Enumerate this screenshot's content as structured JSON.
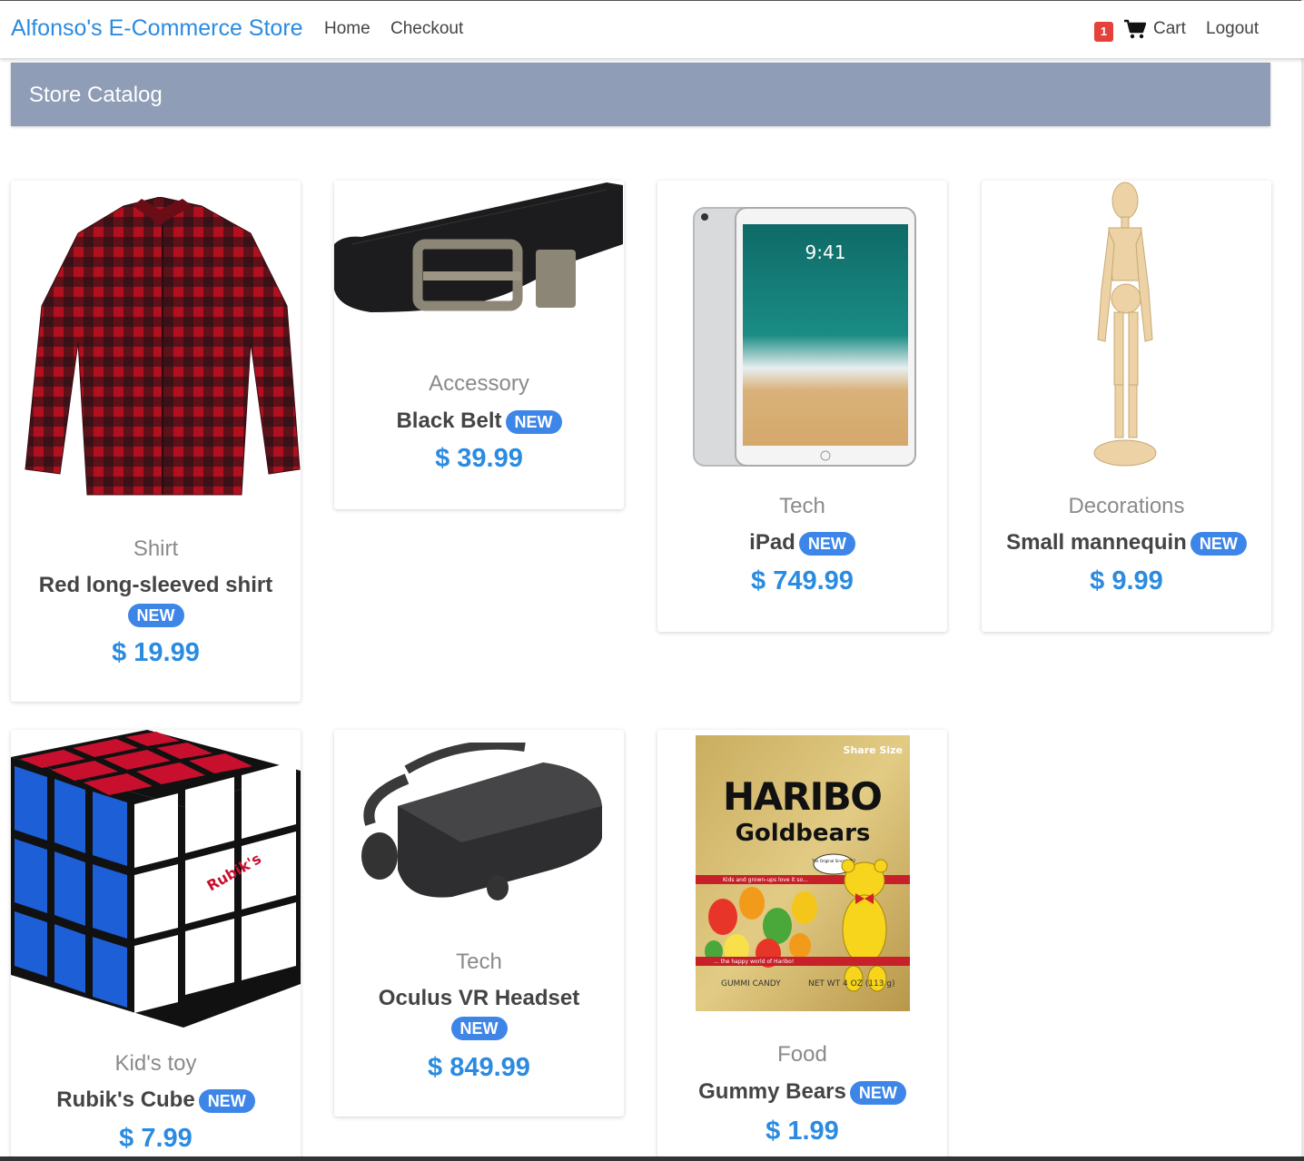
{
  "navbar": {
    "brand": "Alfonso's E-Commerce Store",
    "links": [
      "Home",
      "Checkout"
    ],
    "cart_count": "1",
    "cart_label": "Cart",
    "logout_label": "Logout"
  },
  "catalog": {
    "title": "Store Catalog"
  },
  "new_badge": "NEW",
  "products": [
    {
      "category": "Shirt",
      "name": "Red long-sleeved shirt",
      "price": "$ 19.99"
    },
    {
      "category": "Accessory",
      "name": "Black Belt",
      "price": "$ 39.99"
    },
    {
      "category": "Tech",
      "name": "iPad",
      "price": "$ 749.99"
    },
    {
      "category": "Decorations",
      "name": "Small mannequin",
      "price": "$ 9.99"
    },
    {
      "category": "Kid's toy",
      "name": "Rubik's Cube",
      "price": "$ 7.99"
    },
    {
      "category": "Tech",
      "name": "Oculus VR Headset",
      "price": "$ 849.99"
    },
    {
      "category": "Food",
      "name": "Gummy Bears",
      "price": "$ 1.99"
    }
  ],
  "product_image_text": {
    "haribo_brand": "HARIBO",
    "haribo_product": "Goldbears",
    "haribo_share": "Share Size",
    "haribo_gummi": "GUMMI CANDY",
    "haribo_weight": "NET WT 4 OZ (113 g)",
    "haribo_tagline": "Kids and grown-ups love it so...",
    "haribo_slogan": "... the happy world of Haribo!",
    "haribo_since": "The Original Since 1922",
    "ipad_time": "9:41",
    "rubiks_logo": "Rubik's"
  },
  "colors": {
    "brand": "#2b8be0",
    "catalog_bar": "#8f9db7",
    "badge": "#e6403b",
    "new_badge": "#3d86e8",
    "price": "#2b8be0"
  },
  "icons": [
    "cart-icon"
  ]
}
